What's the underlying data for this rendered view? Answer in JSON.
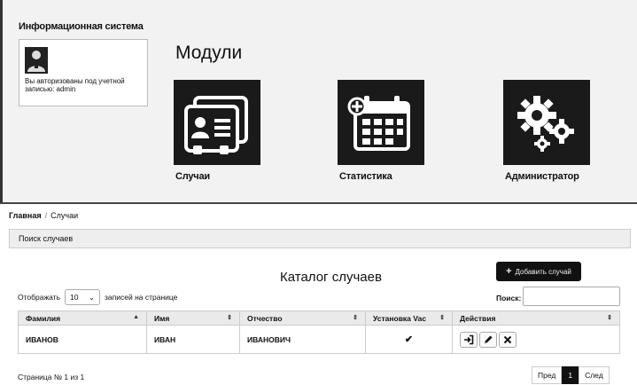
{
  "app": {
    "title": "Информационная система",
    "user_info": "Вы авторизованы под учетной записью: admin"
  },
  "modules": {
    "title": "Модули",
    "items": [
      {
        "label": "Случаи",
        "icon": "id-cards-icon"
      },
      {
        "label": "Статистика",
        "icon": "calendar-add-icon"
      },
      {
        "label": "Администратор",
        "icon": "gears-icon"
      }
    ]
  },
  "breadcrumb": {
    "home": "Главная",
    "separator": "/",
    "current": "Случаи"
  },
  "search_panel": {
    "title": "Поиск случаев"
  },
  "catalog": {
    "title": "Каталог случаев",
    "add_button": "Добавить случай",
    "show_prefix": "Отображать",
    "page_size": "10",
    "show_suffix": "записей на странице",
    "search_label": "Поиск:",
    "search_value": ""
  },
  "table": {
    "headers": [
      "Фамилия",
      "Имя",
      "Отчество",
      "Установка Vac",
      "Действия"
    ],
    "rows": [
      {
        "last_name": "ИВАНОВ",
        "first_name": "ИВАН",
        "patronymic": "ИВАНОВИЧ",
        "vac": "✔"
      }
    ]
  },
  "pagination": {
    "info": "Страница № 1 из 1",
    "prev": "Пред",
    "current": "1",
    "next": "След"
  }
}
